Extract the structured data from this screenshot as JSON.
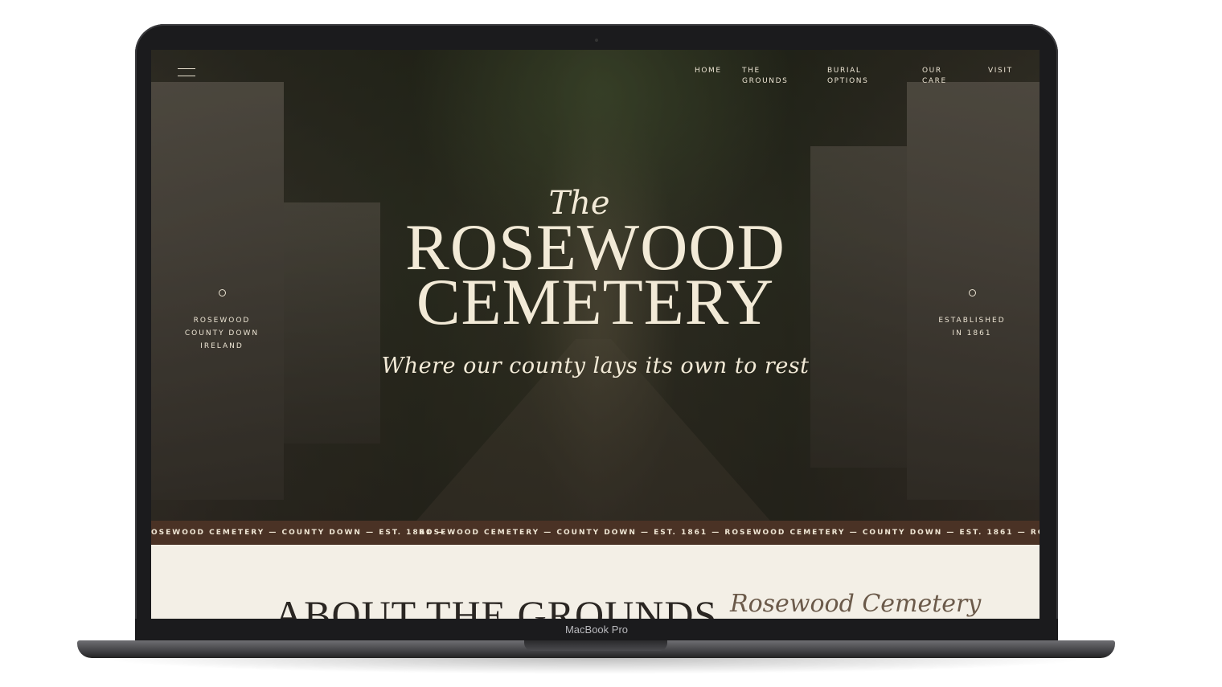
{
  "nav": {
    "home": "HOME",
    "grounds": "THE\nGROUNDS",
    "burial": "BURIAL\nOPTIONS",
    "care": "OUR\nCARE",
    "visit": "VISIT"
  },
  "hero": {
    "the": "The",
    "title_line1": "ROSEWOOD",
    "title_line2": "CEMETERY",
    "tagline": "Where our county lays its own to rest",
    "left_caption": "ROSEWOOD\nCOUNTY DOWN\nIRELAND",
    "right_caption": "ESTABLISHED\nIN 1861"
  },
  "marquee": {
    "text_partial": "OSEWOOD CEMETERY — COUNTY DOWN — EST. 1861 —",
    "text_main": "ROSEWOOD CEMETERY — COUNTY DOWN — EST. 1861 — ROSEWOOD CEMETERY — COUNTY DOWN — EST. 1861 — ROSEWOOD CEMETERY —"
  },
  "about": {
    "title": "ABOUT THE GROUNDS",
    "script": "Rosewood Cemetery"
  },
  "device": {
    "brand": "MacBook Pro"
  },
  "icons": {
    "menu": "hamburger-icon",
    "dot": "circle-icon"
  }
}
